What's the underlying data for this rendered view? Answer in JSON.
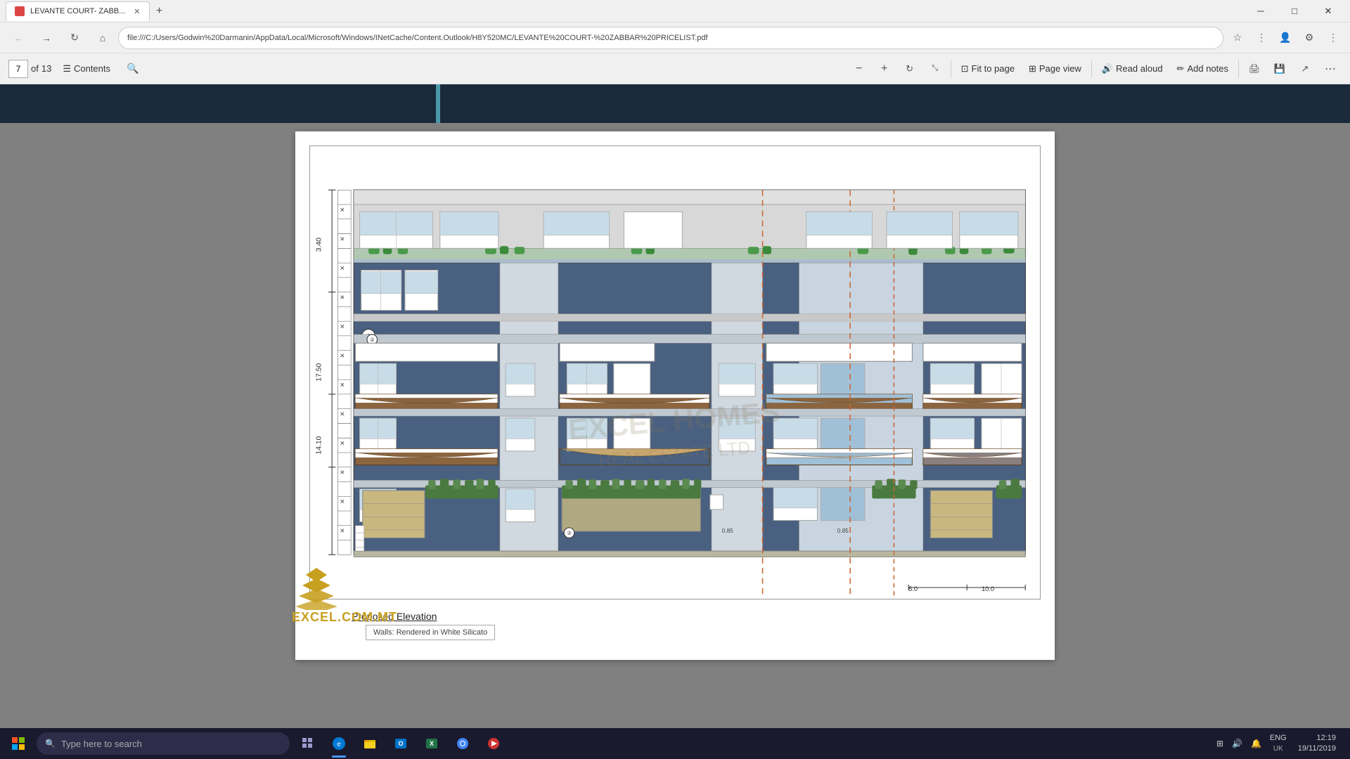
{
  "browser": {
    "tab_title": "LEVANTE COURT- ZABB...",
    "tab_icon": "pdf-icon",
    "url": "file:///C:/Users/Godwin%20Darmanin/AppData/Local/Microsoft/Windows/INetCache/Content.Outlook/H8Y520MC/LEVANTE%20COURT-%20ZABBAR%20PRICELIST.pdf",
    "controls": {
      "minimize": "─",
      "maximize": "□",
      "close": "✕"
    },
    "nav": {
      "back": "←",
      "forward": "→",
      "refresh": "↻",
      "home": "⌂"
    }
  },
  "pdf_toolbar": {
    "page_current": "7",
    "page_total": "13",
    "contents_label": "Contents",
    "zoom_out": "−",
    "zoom_in": "+",
    "fit_to_page": "Fit to page",
    "page_view": "Page view",
    "read_aloud": "Read aloud",
    "add_notes": "Add notes",
    "more_tools": "⋯"
  },
  "pdf_content": {
    "drawing_title": "Proposed Elevation",
    "watermark_text": "EXCEL HOMES",
    "watermark_sub": "REAL ESTATE LTD",
    "caption_text": "Walls: Rendered in White Silicato",
    "dimensions": {
      "height_top": "3.40",
      "height_mid1": "17.50",
      "height_mid2": "14.10",
      "dim_1": "0.85",
      "dim_2": "0.85",
      "scale_right": "5.0",
      "scale_right2": "10.0"
    }
  },
  "logo": {
    "main_text": "EXCEL.COM.MT",
    "stacked_lines": "EXCEL\nHOMES",
    "sub": "REAL ESTATE LTD"
  },
  "taskbar": {
    "search_placeholder": "Type here to search",
    "apps": [
      "windows-icon",
      "task-view-icon",
      "edge-icon",
      "explorer-icon",
      "outlook-icon",
      "excel-icon",
      "chrome-icon",
      "app-icon"
    ],
    "system": {
      "lang": "ENG\nUK",
      "time": "12:19",
      "date": "19/11/2019"
    }
  }
}
